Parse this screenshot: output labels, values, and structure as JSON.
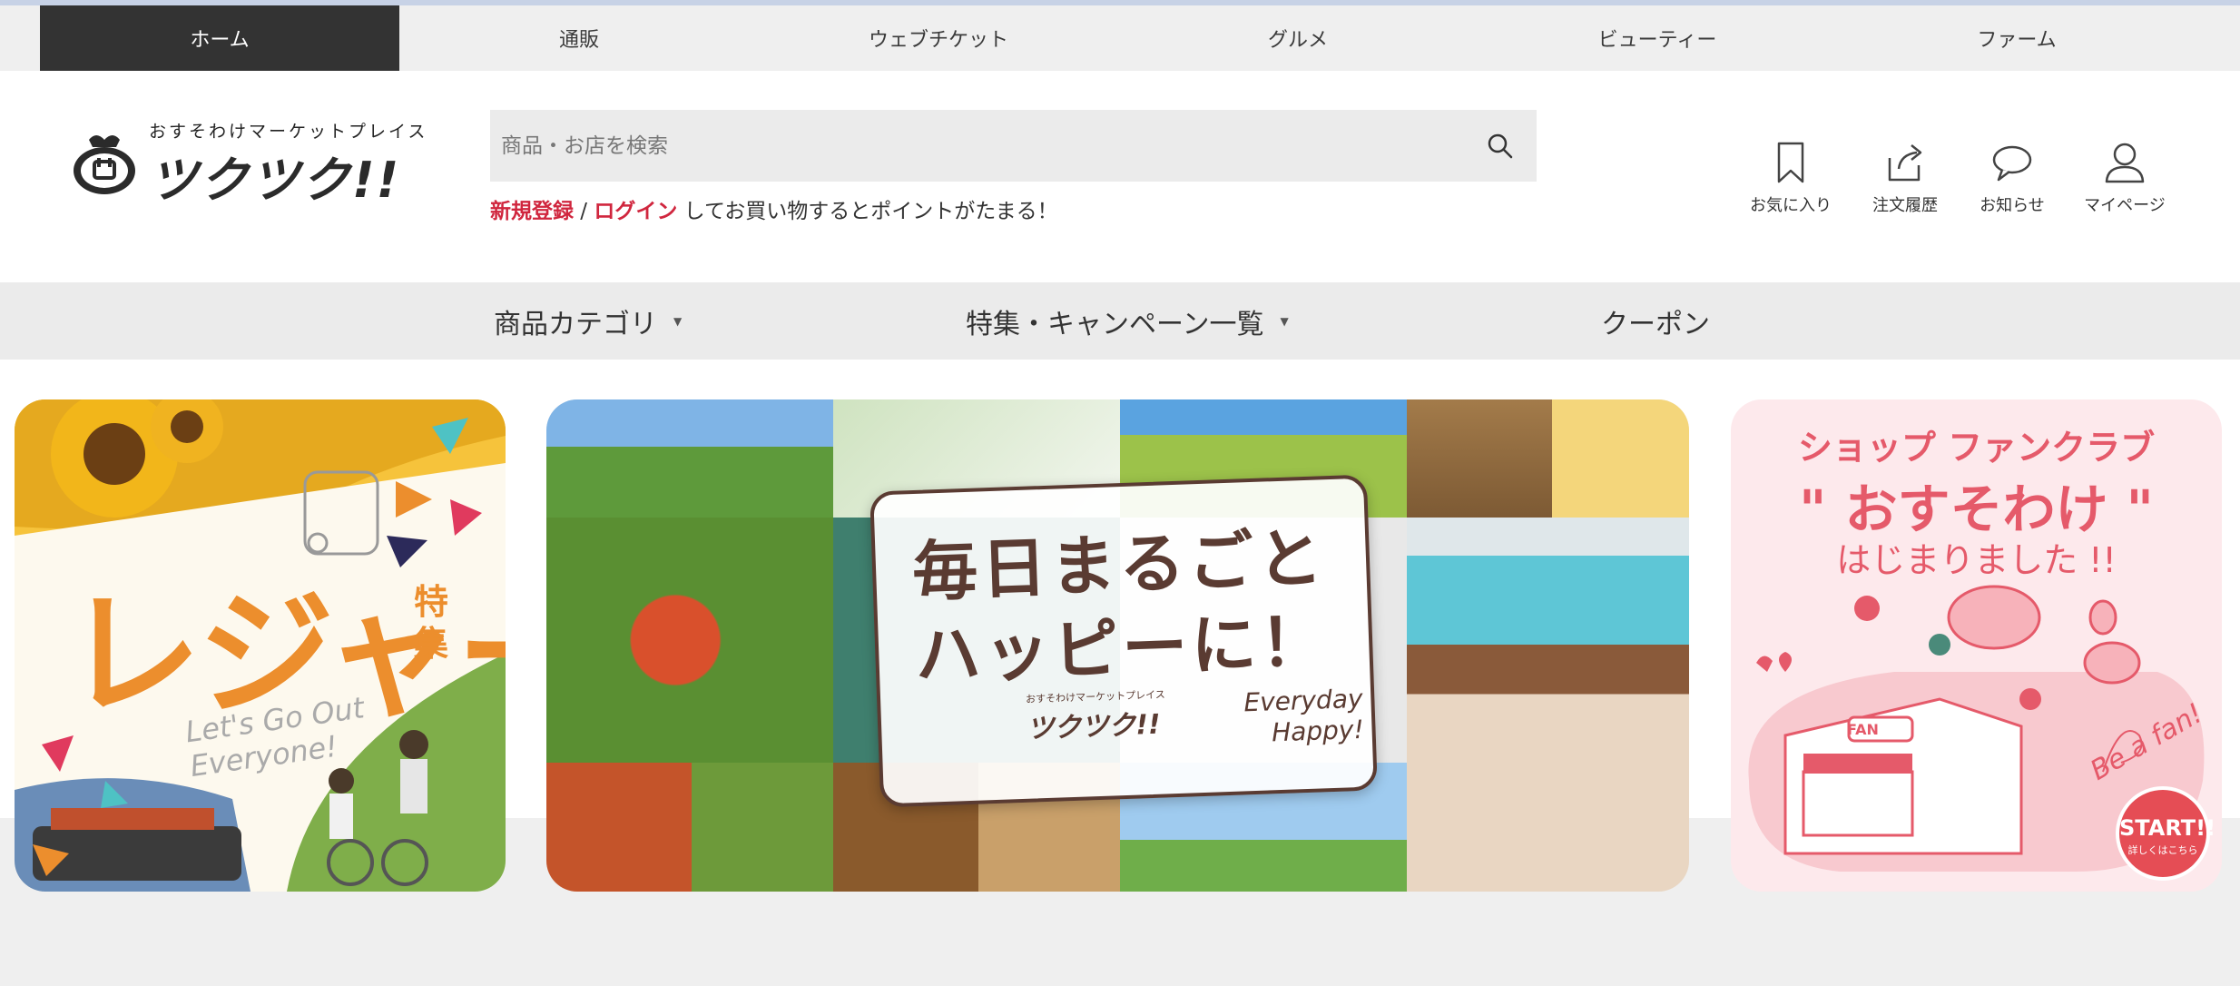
{
  "top_tabs": [
    {
      "label": "ホーム",
      "active": true
    },
    {
      "label": "通販",
      "active": false
    },
    {
      "label": "ウェブチケット",
      "active": false
    },
    {
      "label": "グルメ",
      "active": false
    },
    {
      "label": "ビューティー",
      "active": false
    },
    {
      "label": "ファーム",
      "active": false
    }
  ],
  "logo": {
    "subtitle": "おすそわけマーケットプレイス",
    "name": "ツクツク!!"
  },
  "search": {
    "placeholder": "商品・お店を検索",
    "icon": "search-icon"
  },
  "promo": {
    "register": "新規登録",
    "separator": " / ",
    "login": "ログイン",
    "message": " してお買い物するとポイントがたまる！"
  },
  "header_icons": [
    {
      "label": "お気に入り",
      "icon": "bookmark-icon"
    },
    {
      "label": "注文履歴",
      "icon": "share-icon"
    },
    {
      "label": "お知らせ",
      "icon": "speech-bubble-icon"
    },
    {
      "label": "マイページ",
      "icon": "user-icon"
    }
  ],
  "category_nav": [
    {
      "label": "商品カテゴリ",
      "dropdown": true
    },
    {
      "label": "特集・キャンペーン一覧",
      "dropdown": true
    },
    {
      "label": "クーポン",
      "dropdown": false
    }
  ],
  "banners": {
    "leisure": {
      "title": "レジャー",
      "suffix": "特集",
      "tagline": "Let's Go Out Everyone!"
    },
    "happy": {
      "headline_line1": "毎日まるごと",
      "headline_line2": "ハッピーに！",
      "brand_sub": "おすそわけマーケットプレイス",
      "brand": "ツクツク!!",
      "everyday_line1": "Everyday",
      "everyday_line2": "Happy!"
    },
    "fanclub": {
      "line1": "ショップ ファンクラブ",
      "line2": "\" おすそわけ \"",
      "line3": "はじまりました !!",
      "badge_main": "START!!",
      "badge_sub": "詳しくはこちら",
      "fan_sign": "FAN",
      "script": "Be a fan!"
    }
  },
  "colors": {
    "accent_red": "#d0263e",
    "active_tab": "#333333",
    "leisure_orange": "#ec8e2d",
    "fanclub_pink": "#e55a6a",
    "happy_brown": "#5a3b32"
  }
}
